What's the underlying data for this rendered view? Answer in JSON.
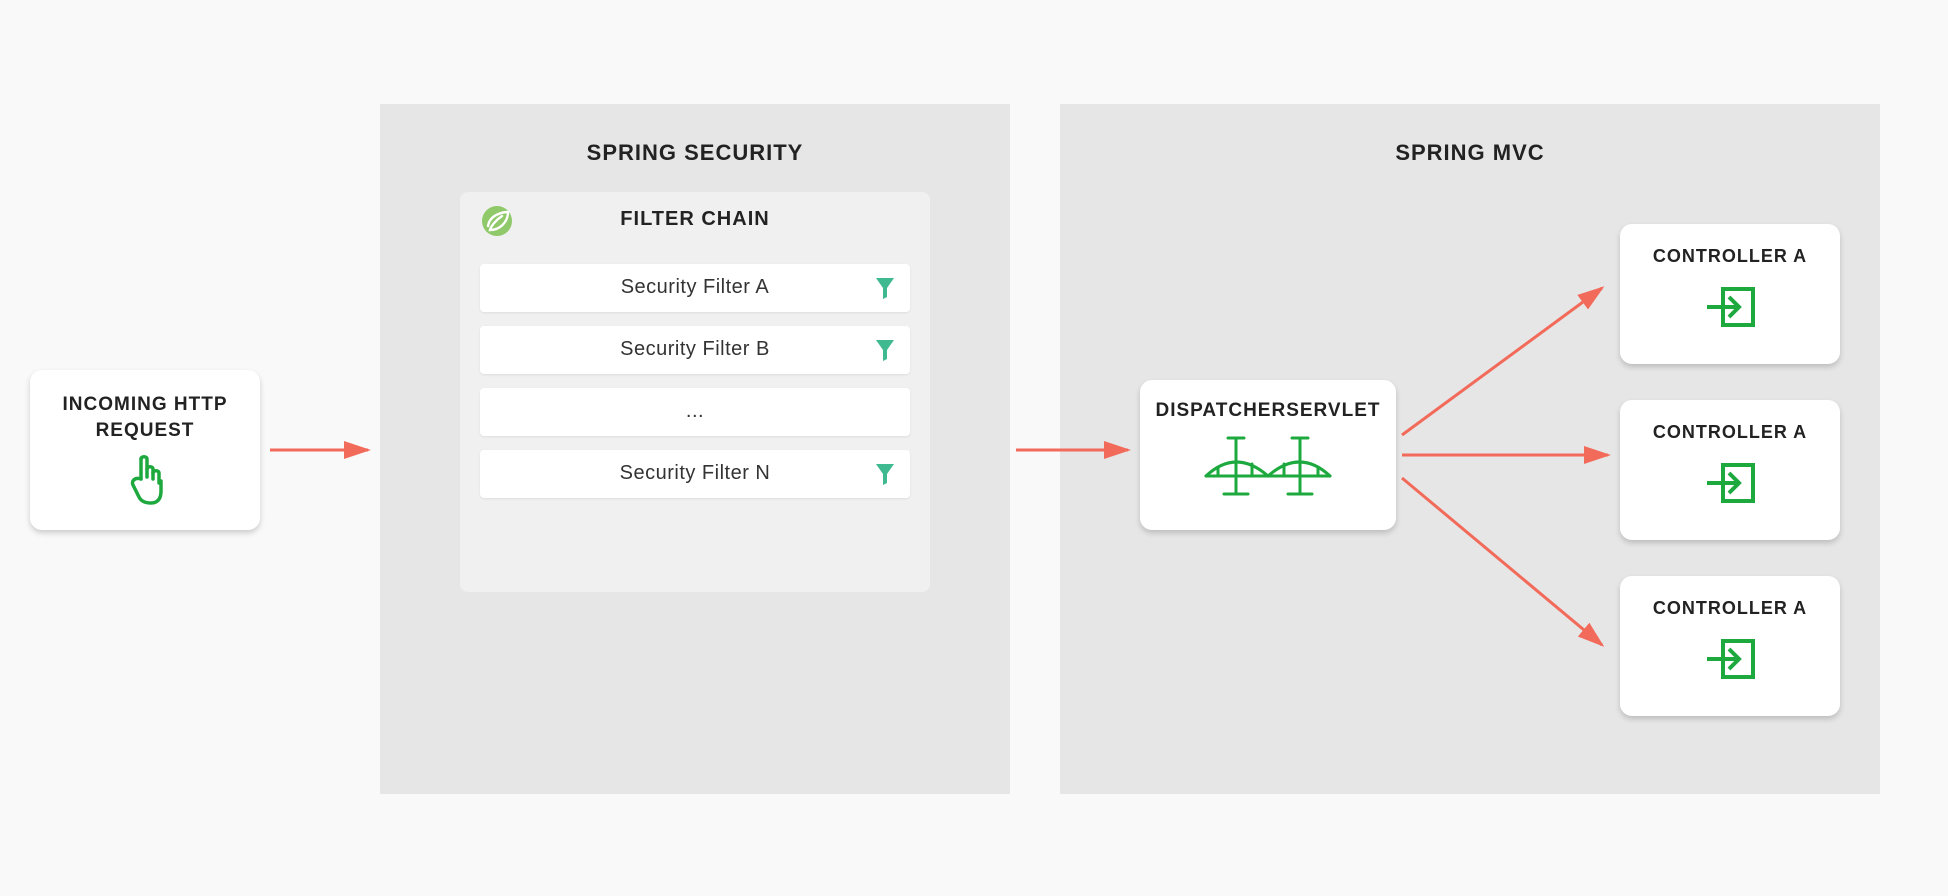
{
  "incoming": {
    "line1": "INCOMING HTTP",
    "line2": "REQUEST"
  },
  "security": {
    "title": "SPRING SECURITY",
    "chain_title": "FILTER CHAIN",
    "filters": [
      {
        "label": "Security Filter A",
        "icon": true
      },
      {
        "label": "Security Filter B",
        "icon": true
      },
      {
        "label": "...",
        "icon": false
      },
      {
        "label": "Security Filter N",
        "icon": true
      }
    ]
  },
  "mvc": {
    "title": "SPRING MVC",
    "dispatcher": "DISPATCHERSERVLET",
    "controllers": [
      {
        "label": "CONTROLLER A"
      },
      {
        "label": "CONTROLLER A"
      },
      {
        "label": "CONTROLLER A"
      }
    ]
  },
  "colors": {
    "arrow": "#f26a5a",
    "green": "#1ea93f",
    "teal": "#3fb98f"
  }
}
